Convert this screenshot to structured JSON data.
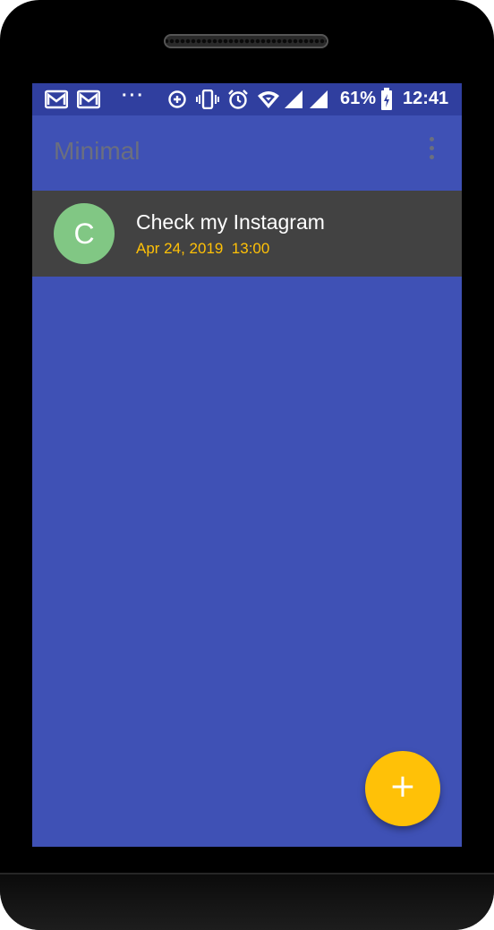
{
  "status_bar": {
    "notification_icons": [
      "gmail-icon",
      "gmail-icon",
      "more-notifications-icon"
    ],
    "system_icons": [
      "data-saver-icon",
      "vibrate-icon",
      "alarm-icon",
      "wifi-icon",
      "signal-icon",
      "signal-icon",
      "battery-charging-icon"
    ],
    "dots": "···",
    "battery_percent": "61%",
    "time": "12:41"
  },
  "toolbar": {
    "title": "Minimal",
    "menu_icon": "more-vert-icon"
  },
  "list": {
    "items": [
      {
        "avatar_letter": "C",
        "avatar_color": "#81c784",
        "title": "Check my Instagram",
        "date": "Apr 24, 2019  13:00"
      }
    ]
  },
  "fab": {
    "icon": "add-icon",
    "symbol": "+"
  },
  "colors": {
    "primary": "#3f51b5",
    "primary_dark": "#303f9f",
    "accent": "#ffc107",
    "list_item_background": "#424242"
  }
}
